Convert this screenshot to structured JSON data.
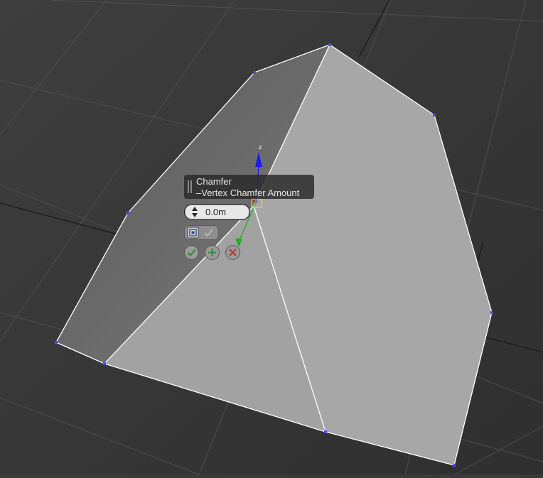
{
  "caddy": {
    "title": "Chamfer",
    "parameter": "Vertex Chamfer Amount",
    "amount_value": "0.0m"
  },
  "icons": {
    "spinner": "up-down-spinner-icon",
    "chamfer_option": "chamfer-option-icon",
    "checkbox": "check-icon",
    "ok": "checkmark-icon",
    "apply": "plus-icon",
    "cancel": "x-icon",
    "gizmo_z_label": "z"
  },
  "colors": {
    "viewport_bg": "#3a3a3a",
    "mesh_light": "#a5a5a5",
    "mesh_dark": "#6f6f6f",
    "vertex": "#3a3aff",
    "ok_green": "#2e8b2e",
    "cancel_red": "#c03030",
    "gizmo_z": "#1a1aff",
    "gizmo_y": "#1fae1f",
    "gizmo_x": "#d02020"
  }
}
